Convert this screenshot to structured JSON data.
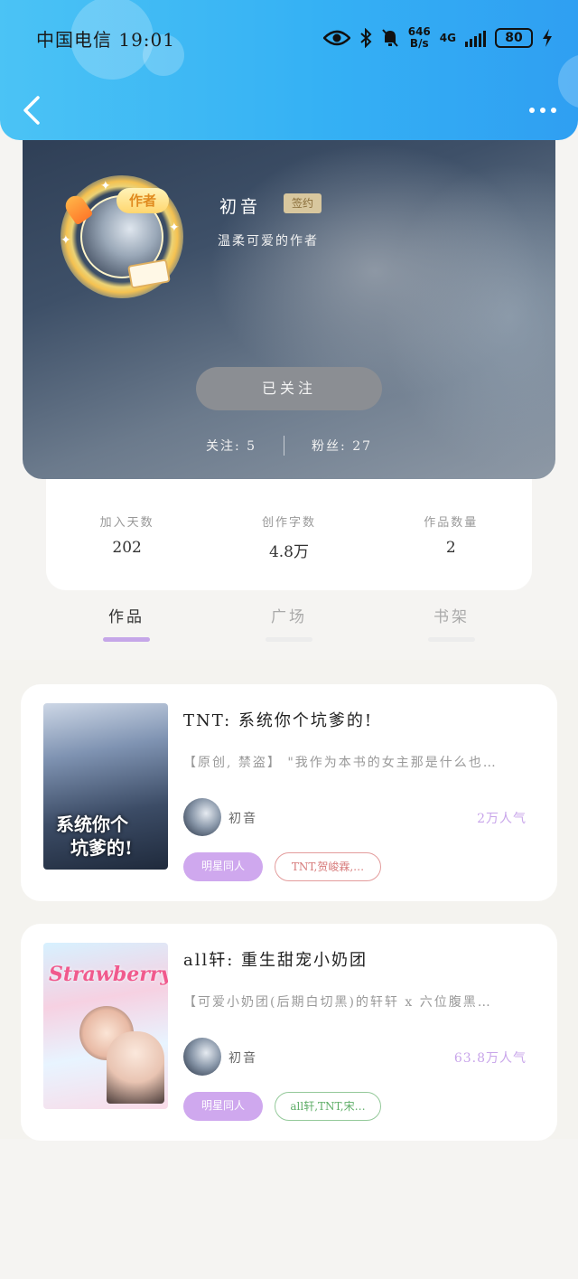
{
  "status_bar": {
    "carrier_time": "中国电信 19:01",
    "net_speed_value": "646",
    "net_speed_unit": "B/s",
    "network": "4G",
    "battery": "80"
  },
  "profile": {
    "author_badge": "作者",
    "name": "初音",
    "signed_label": "签约",
    "bio": "温柔可爱的作者",
    "follow_button": "已关注",
    "following_label": "关注",
    "following_count": "5",
    "fans_label": "粉丝",
    "fans_count": "27"
  },
  "stats": [
    {
      "label": "加入天数",
      "value": "202"
    },
    {
      "label": "创作字数",
      "value": "4.8万"
    },
    {
      "label": "作品数量",
      "value": "2"
    }
  ],
  "tabs": [
    {
      "label": "作品",
      "active": true
    },
    {
      "label": "广场",
      "active": false
    },
    {
      "label": "书架",
      "active": false
    }
  ],
  "books": [
    {
      "cover_text_1": "系统你个",
      "cover_text_2": "坑爹的!",
      "title": "TNT: 系统你个坑爹的!",
      "description": "【原创, 禁盗】 \"我作为本书的女主那是什么也…",
      "author": "初音",
      "popularity": "2万人气",
      "tag_primary": "明星同人",
      "tag_secondary": "TNT,贺峻霖,…"
    },
    {
      "cover_text_1": "Strawberry",
      "title": "all轩: 重生甜宠小奶团",
      "description": "【可爱小奶团(后期白切黑)的轩轩 x 六位腹黑…",
      "author": "初音",
      "popularity": "63.8万人气",
      "tag_primary": "明星同人",
      "tag_secondary": "all轩,TNT,宋…"
    }
  ],
  "colors": {
    "topbar_start": "#4bc3f5",
    "topbar_end": "#2f9ff2",
    "accent_purple": "#c5a6e8",
    "tag_red": "#e39c9c",
    "tag_green": "#94c99a"
  },
  "icons": [
    "eye-icon",
    "bluetooth-icon",
    "mute-icon",
    "signal-icon",
    "battery-icon",
    "charging-icon",
    "back-icon",
    "more-icon"
  ]
}
